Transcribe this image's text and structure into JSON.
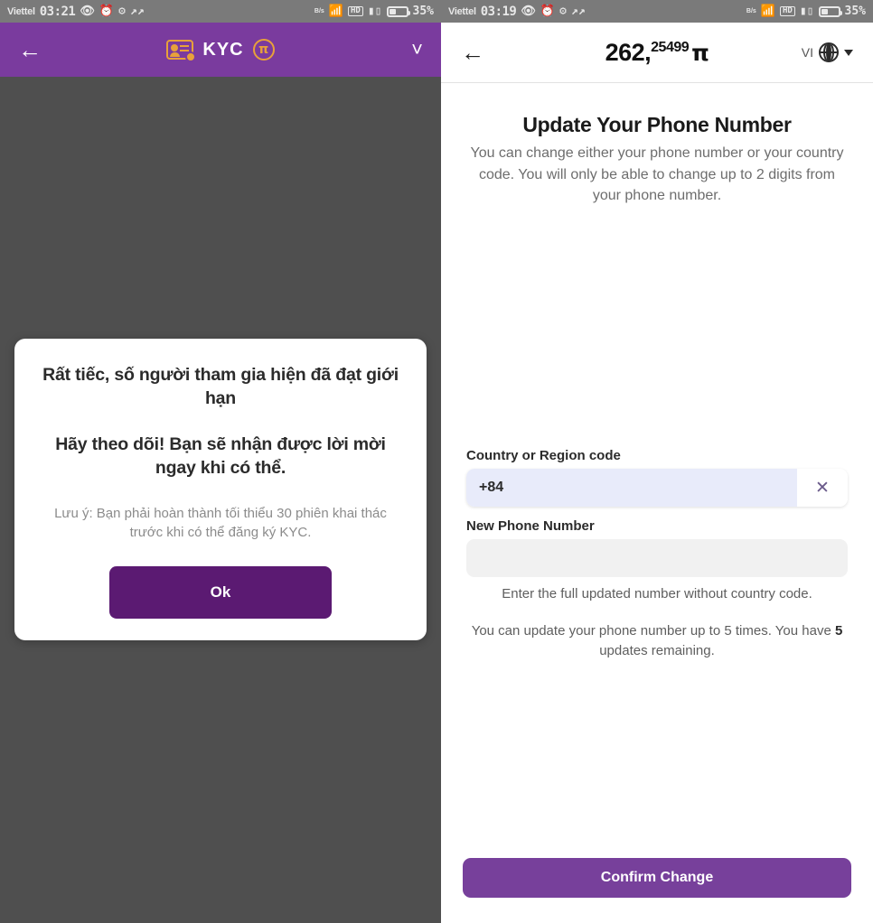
{
  "left": {
    "statusbar": {
      "carrier": "Viettel",
      "time": "03:21",
      "icons": [
        "eye-icon",
        "alarm-icon",
        "bluetooth-icon",
        "sync-icon"
      ],
      "data_rate": "B/s",
      "right_icons": [
        "wifi-icon",
        "hd-icon",
        "signal-icon"
      ],
      "battery_percent": "35%"
    },
    "appbar": {
      "back_icon": "back-arrow-icon",
      "card_icon": "id-card-icon",
      "title": "KYC",
      "coin_icon": "pi-coin-icon",
      "coin_symbol": "π",
      "chevron_icon": "chevron-down-icon"
    },
    "dialog": {
      "heading1": "Rất tiếc, số người tham gia hiện đã đạt giới hạn",
      "heading2": "Hãy theo dõi! Bạn sẽ nhận được lời mời ngay khi có thể.",
      "note": "Lưu ý: Bạn phải hoàn thành tối thiểu 30 phiên khai thác trước khi có thể đăng ký KYC.",
      "ok_label": "Ok"
    }
  },
  "right": {
    "statusbar": {
      "carrier": "Viettel",
      "time": "03:19",
      "data_rate": "B/s",
      "battery_percent": "35%"
    },
    "header": {
      "back_icon": "back-arrow-icon",
      "balance_whole": "262,",
      "balance_decimals": "25499",
      "balance_unit": "π",
      "language_code": "VI",
      "globe_icon": "globe-icon",
      "caret_icon": "caret-down-icon"
    },
    "page": {
      "title": "Update Your Phone Number",
      "subtitle": "You can change either your phone number or your country code. You will only be able to change up to 2 digits from your phone number."
    },
    "form": {
      "country_label": "Country or Region code",
      "country_value": "+84",
      "country_placeholder": "",
      "clear_icon": "close-icon",
      "phone_label": "New Phone Number",
      "phone_value": "",
      "phone_placeholder": "",
      "hint": "Enter the full updated number without country code.",
      "quota_prefix": "You can update your phone number up to 5 times. You have ",
      "quota_count": "5",
      "quota_suffix": " updates remaining."
    },
    "confirm_label": "Confirm Change"
  },
  "colors": {
    "appbar_purple": "#7a3b9e",
    "ok_button_purple": "#5b1a72",
    "confirm_purple": "#77409b",
    "scrim_gray": "#4f4f4f",
    "statusbar_gray": "#7a7a7a",
    "accent_orange": "#e8a13a",
    "input_lavender": "#e8ebfa",
    "input_gray": "#f1f1f1"
  }
}
